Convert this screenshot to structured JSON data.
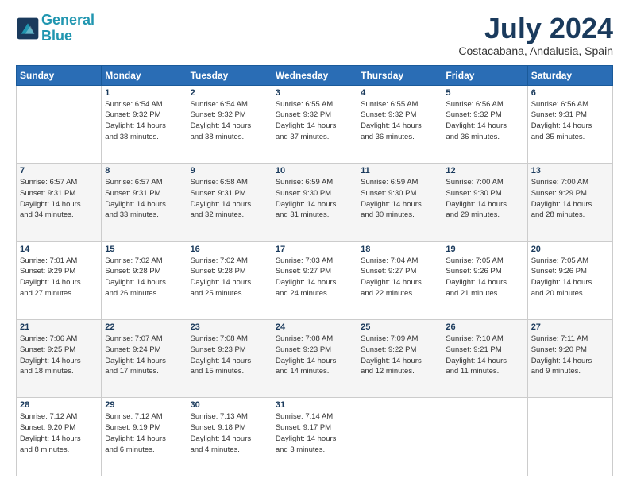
{
  "logo": {
    "line1": "General",
    "line2": "Blue"
  },
  "title": "July 2024",
  "subtitle": "Costacabana, Andalusia, Spain",
  "header_days": [
    "Sunday",
    "Monday",
    "Tuesday",
    "Wednesday",
    "Thursday",
    "Friday",
    "Saturday"
  ],
  "weeks": [
    [
      {
        "day": "",
        "info": ""
      },
      {
        "day": "1",
        "info": "Sunrise: 6:54 AM\nSunset: 9:32 PM\nDaylight: 14 hours\nand 38 minutes."
      },
      {
        "day": "2",
        "info": "Sunrise: 6:54 AM\nSunset: 9:32 PM\nDaylight: 14 hours\nand 38 minutes."
      },
      {
        "day": "3",
        "info": "Sunrise: 6:55 AM\nSunset: 9:32 PM\nDaylight: 14 hours\nand 37 minutes."
      },
      {
        "day": "4",
        "info": "Sunrise: 6:55 AM\nSunset: 9:32 PM\nDaylight: 14 hours\nand 36 minutes."
      },
      {
        "day": "5",
        "info": "Sunrise: 6:56 AM\nSunset: 9:32 PM\nDaylight: 14 hours\nand 36 minutes."
      },
      {
        "day": "6",
        "info": "Sunrise: 6:56 AM\nSunset: 9:31 PM\nDaylight: 14 hours\nand 35 minutes."
      }
    ],
    [
      {
        "day": "7",
        "info": "Sunrise: 6:57 AM\nSunset: 9:31 PM\nDaylight: 14 hours\nand 34 minutes."
      },
      {
        "day": "8",
        "info": "Sunrise: 6:57 AM\nSunset: 9:31 PM\nDaylight: 14 hours\nand 33 minutes."
      },
      {
        "day": "9",
        "info": "Sunrise: 6:58 AM\nSunset: 9:31 PM\nDaylight: 14 hours\nand 32 minutes."
      },
      {
        "day": "10",
        "info": "Sunrise: 6:59 AM\nSunset: 9:30 PM\nDaylight: 14 hours\nand 31 minutes."
      },
      {
        "day": "11",
        "info": "Sunrise: 6:59 AM\nSunset: 9:30 PM\nDaylight: 14 hours\nand 30 minutes."
      },
      {
        "day": "12",
        "info": "Sunrise: 7:00 AM\nSunset: 9:30 PM\nDaylight: 14 hours\nand 29 minutes."
      },
      {
        "day": "13",
        "info": "Sunrise: 7:00 AM\nSunset: 9:29 PM\nDaylight: 14 hours\nand 28 minutes."
      }
    ],
    [
      {
        "day": "14",
        "info": "Sunrise: 7:01 AM\nSunset: 9:29 PM\nDaylight: 14 hours\nand 27 minutes."
      },
      {
        "day": "15",
        "info": "Sunrise: 7:02 AM\nSunset: 9:28 PM\nDaylight: 14 hours\nand 26 minutes."
      },
      {
        "day": "16",
        "info": "Sunrise: 7:02 AM\nSunset: 9:28 PM\nDaylight: 14 hours\nand 25 minutes."
      },
      {
        "day": "17",
        "info": "Sunrise: 7:03 AM\nSunset: 9:27 PM\nDaylight: 14 hours\nand 24 minutes."
      },
      {
        "day": "18",
        "info": "Sunrise: 7:04 AM\nSunset: 9:27 PM\nDaylight: 14 hours\nand 22 minutes."
      },
      {
        "day": "19",
        "info": "Sunrise: 7:05 AM\nSunset: 9:26 PM\nDaylight: 14 hours\nand 21 minutes."
      },
      {
        "day": "20",
        "info": "Sunrise: 7:05 AM\nSunset: 9:26 PM\nDaylight: 14 hours\nand 20 minutes."
      }
    ],
    [
      {
        "day": "21",
        "info": "Sunrise: 7:06 AM\nSunset: 9:25 PM\nDaylight: 14 hours\nand 18 minutes."
      },
      {
        "day": "22",
        "info": "Sunrise: 7:07 AM\nSunset: 9:24 PM\nDaylight: 14 hours\nand 17 minutes."
      },
      {
        "day": "23",
        "info": "Sunrise: 7:08 AM\nSunset: 9:23 PM\nDaylight: 14 hours\nand 15 minutes."
      },
      {
        "day": "24",
        "info": "Sunrise: 7:08 AM\nSunset: 9:23 PM\nDaylight: 14 hours\nand 14 minutes."
      },
      {
        "day": "25",
        "info": "Sunrise: 7:09 AM\nSunset: 9:22 PM\nDaylight: 14 hours\nand 12 minutes."
      },
      {
        "day": "26",
        "info": "Sunrise: 7:10 AM\nSunset: 9:21 PM\nDaylight: 14 hours\nand 11 minutes."
      },
      {
        "day": "27",
        "info": "Sunrise: 7:11 AM\nSunset: 9:20 PM\nDaylight: 14 hours\nand 9 minutes."
      }
    ],
    [
      {
        "day": "28",
        "info": "Sunrise: 7:12 AM\nSunset: 9:20 PM\nDaylight: 14 hours\nand 8 minutes."
      },
      {
        "day": "29",
        "info": "Sunrise: 7:12 AM\nSunset: 9:19 PM\nDaylight: 14 hours\nand 6 minutes."
      },
      {
        "day": "30",
        "info": "Sunrise: 7:13 AM\nSunset: 9:18 PM\nDaylight: 14 hours\nand 4 minutes."
      },
      {
        "day": "31",
        "info": "Sunrise: 7:14 AM\nSunset: 9:17 PM\nDaylight: 14 hours\nand 3 minutes."
      },
      {
        "day": "",
        "info": ""
      },
      {
        "day": "",
        "info": ""
      },
      {
        "day": "",
        "info": ""
      }
    ]
  ]
}
